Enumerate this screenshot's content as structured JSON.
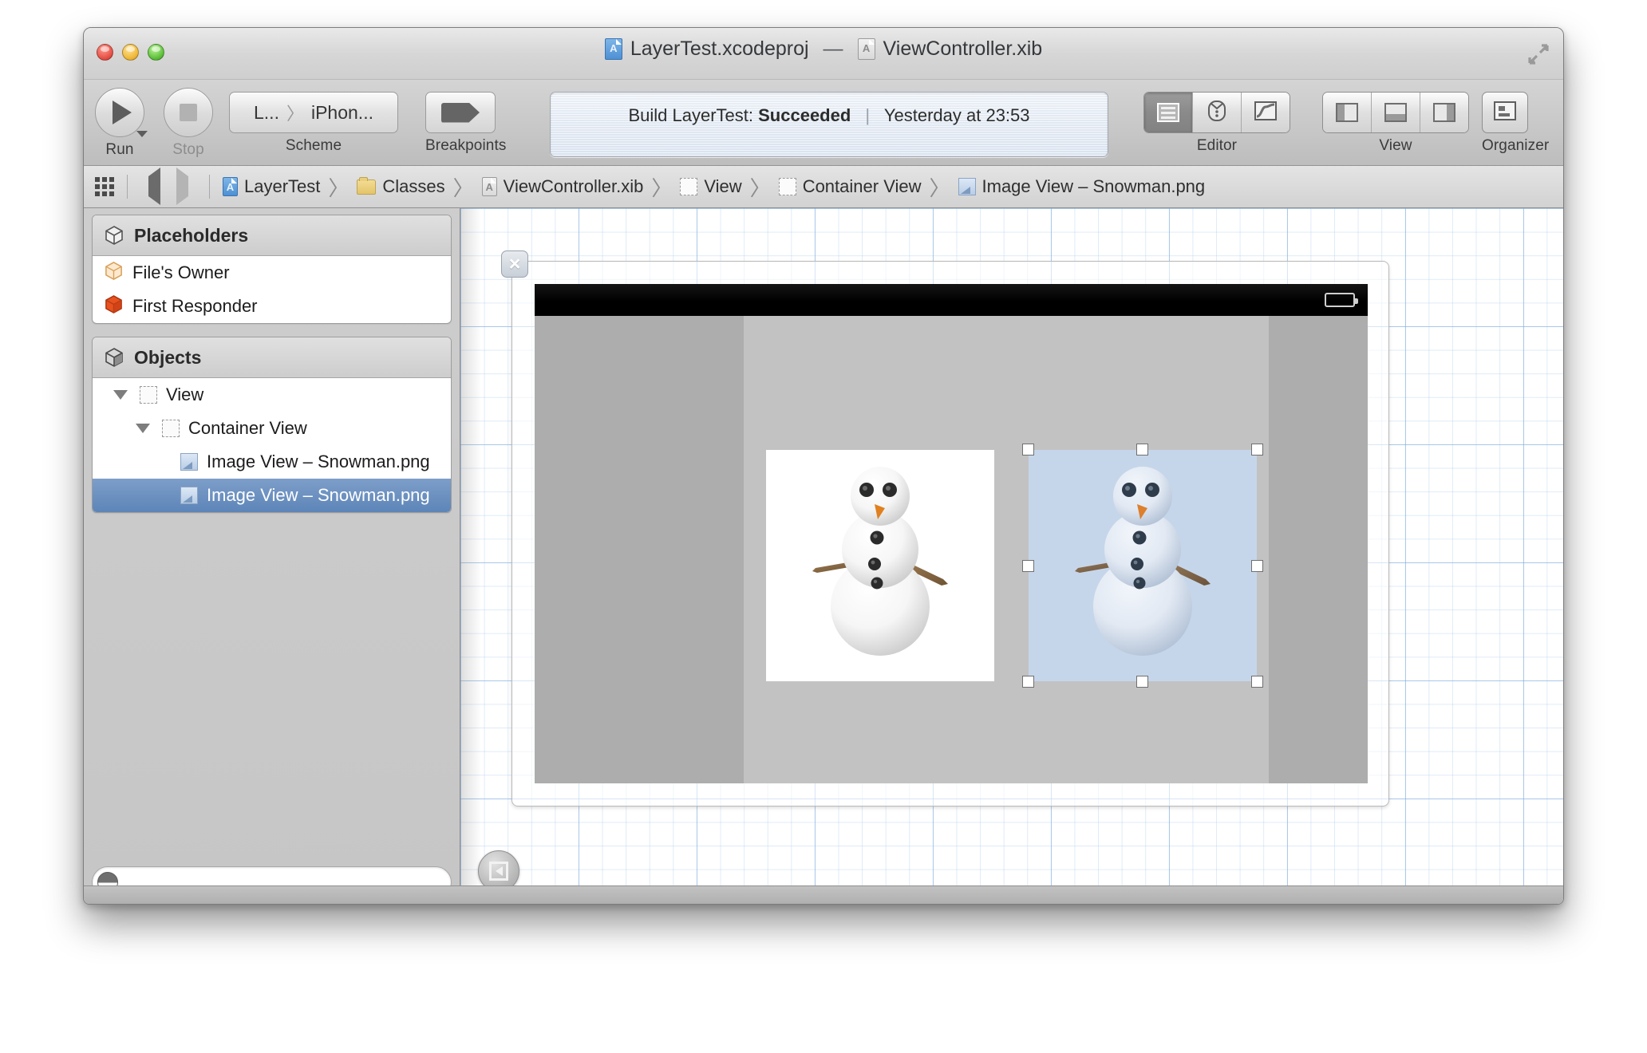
{
  "window": {
    "title_project": "LayerTest.xcodeproj",
    "title_separator": "—",
    "title_file": "ViewController.xib",
    "traffic": [
      "close-button",
      "minimize-button",
      "zoom-button"
    ],
    "fullscreen_label": "fullscreen-icon"
  },
  "toolbar": {
    "run_label": "Run",
    "stop_label": "Stop",
    "scheme_label": "Scheme",
    "scheme_project": "L...",
    "scheme_sep": "〉",
    "scheme_target": "iPhon...",
    "breakpoints_label": "Breakpoints",
    "editor_label": "Editor",
    "view_label": "View",
    "organizer_label": "Organizer",
    "editor_segments": [
      "standard-editor-icon",
      "assistant-editor-icon",
      "version-editor-icon"
    ],
    "view_segments": [
      "toggle-navigator-icon",
      "toggle-debug-area-icon",
      "toggle-utilities-icon"
    ],
    "organizer_icon": "organizer-icon"
  },
  "status": {
    "build_prefix": "Build LayerTest:",
    "build_result": "Succeeded",
    "divider": "|",
    "timestamp": "Yesterday at 23:53"
  },
  "breadcrumb": {
    "grid_icon": "project-grid-icon",
    "back_icon": "back-arrow-icon",
    "forward_icon": "forward-arrow-icon",
    "items": [
      {
        "label": "LayerTest",
        "icon": "xcodeproj-icon"
      },
      {
        "label": "Classes",
        "icon": "folder-icon"
      },
      {
        "label": "ViewController.xib",
        "icon": "xib-icon"
      },
      {
        "label": "View",
        "icon": "view-icon"
      },
      {
        "label": "Container View",
        "icon": "view-icon"
      },
      {
        "label": "Image View – Snowman.png",
        "icon": "imageview-icon"
      }
    ],
    "chevron": "〉"
  },
  "sidebar": {
    "placeholders": {
      "header": "Placeholders",
      "header_icon": "cube-outline-icon",
      "items": [
        {
          "label": "File's Owner",
          "icon": "files-owner-cube-icon"
        },
        {
          "label": "First Responder",
          "icon": "first-responder-cube-icon"
        }
      ]
    },
    "objects": {
      "header": "Objects",
      "header_icon": "cube-filled-icon",
      "items": [
        {
          "label": "View",
          "indent": 0,
          "icon": "view-icon",
          "expanded": true,
          "selected": false
        },
        {
          "label": "Container View",
          "indent": 1,
          "icon": "view-icon",
          "expanded": true,
          "selected": false
        },
        {
          "label": "Image View – Snowman.png",
          "indent": 2,
          "icon": "imageview-icon",
          "expanded": false,
          "selected": false
        },
        {
          "label": "Image View – Snowman.png",
          "indent": 2,
          "icon": "imageview-icon",
          "expanded": false,
          "selected": true
        }
      ]
    },
    "filter_placeholder": ""
  },
  "canvas": {
    "close_button": "×",
    "collapse_button": "hide-outline-icon",
    "battery_icon": "battery-icon",
    "views": {
      "root_view_name": "View",
      "container_view_name": "Container View",
      "image_view_1": "Image View – Snowman.png",
      "image_view_2": "Image View – Snowman.png"
    }
  },
  "colors": {
    "selection_blue": "#5d85b8",
    "selected_imageview_bg": "#c6d6ea",
    "root_view_gray": "#adadad",
    "container_view_gray": "#c2c2c2",
    "status_bar_black": "#000000",
    "grid_blue": "#7daadc",
    "carrot_orange": "#e08020"
  }
}
